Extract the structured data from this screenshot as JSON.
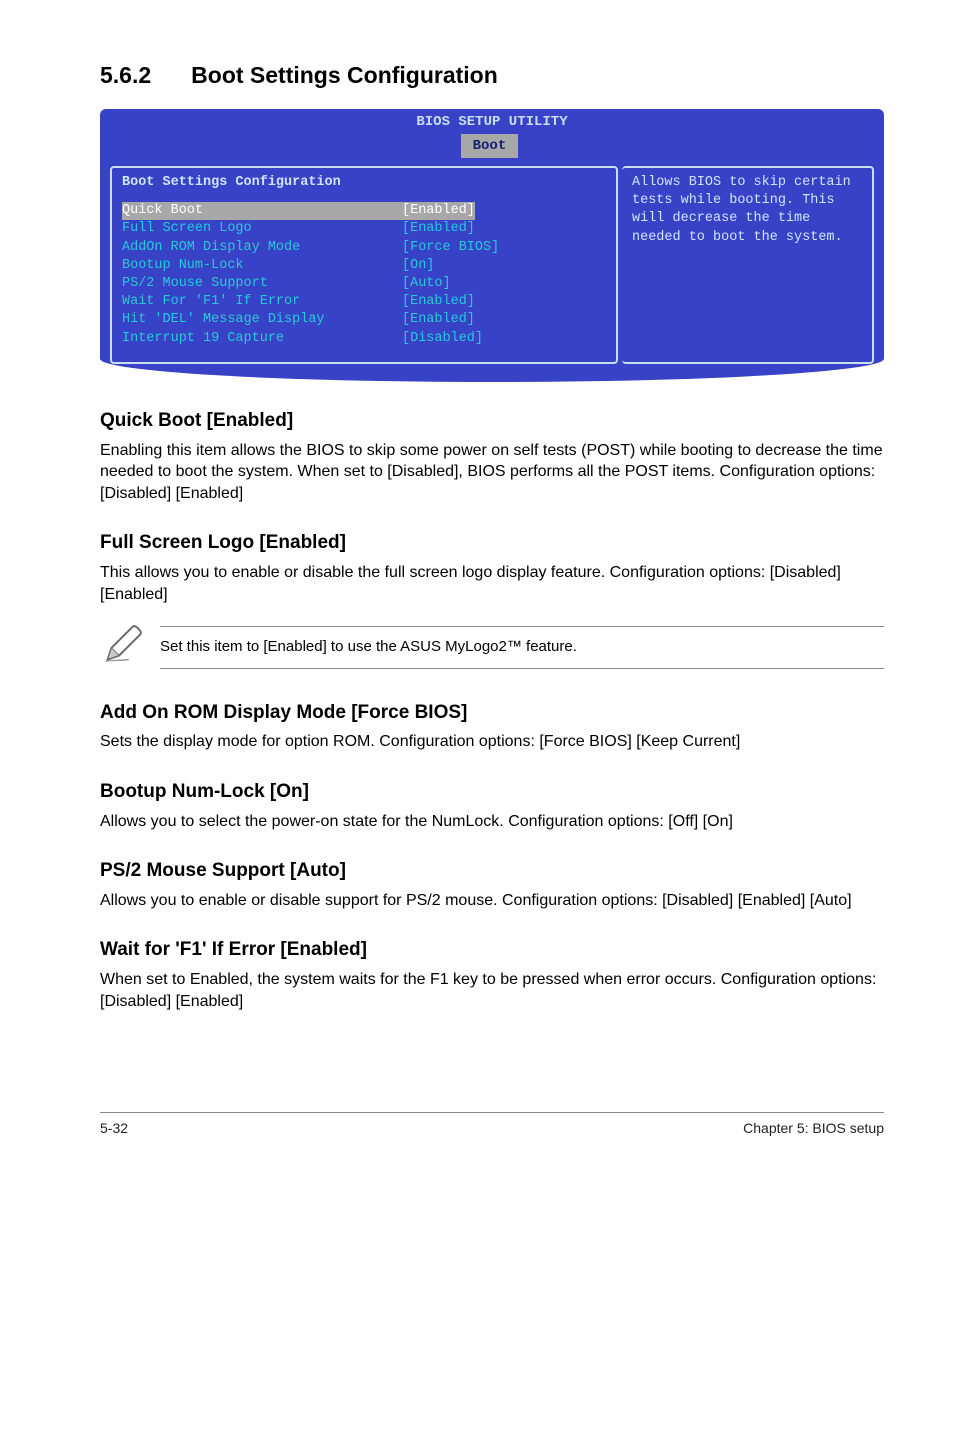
{
  "section": {
    "number": "5.6.2",
    "title": "Boot Settings Configuration"
  },
  "bios": {
    "utility_title": "BIOS SETUP UTILITY",
    "tab": "Boot",
    "panel_heading": "Boot Settings Configuration",
    "rows": [
      {
        "label": "Quick Boot",
        "value": "[Enabled]",
        "selected": true
      },
      {
        "label": "Full Screen Logo",
        "value": "[Enabled]"
      },
      {
        "label": "AddOn ROM Display Mode",
        "value": "[Force BIOS]"
      },
      {
        "label": "Bootup Num-Lock",
        "value": "[On]"
      },
      {
        "label": "PS/2 Mouse Support",
        "value": "[Auto]"
      },
      {
        "label": "Wait For 'F1' If Error",
        "value": "[Enabled]"
      },
      {
        "label": "Hit 'DEL' Message Display",
        "value": "[Enabled]"
      },
      {
        "label": "Interrupt 19 Capture",
        "value": "[Disabled]"
      }
    ],
    "help_text": "Allows BIOS to skip certain tests while booting. This will decrease the time needed to boot the system."
  },
  "sections": {
    "quick_boot": {
      "heading": "Quick Boot [Enabled]",
      "body": "Enabling this item allows the BIOS to skip some power on self tests (POST) while booting to decrease the time needed to boot the system. When set to [Disabled], BIOS performs all the POST items. Configuration options: [Disabled] [Enabled]"
    },
    "full_screen_logo": {
      "heading": "Full Screen Logo [Enabled]",
      "body": "This allows you to enable or disable the full screen logo display feature. Configuration options: [Disabled] [Enabled]"
    },
    "note": {
      "text": "Set this item to [Enabled] to use the ASUS MyLogo2™ feature."
    },
    "addon_rom": {
      "heading": "Add On ROM Display Mode [Force BIOS]",
      "body": "Sets the display mode for option ROM. Configuration options: [Force BIOS] [Keep Current]"
    },
    "bootup_numlock": {
      "heading": "Bootup Num-Lock [On]",
      "body": "Allows you to select the power-on state for the NumLock. Configuration options: [Off] [On]"
    },
    "ps2_mouse": {
      "heading": "PS/2 Mouse Support [Auto]",
      "body": "Allows you to enable or disable support for PS/2 mouse. Configuration options: [Disabled] [Enabled] [Auto]"
    },
    "wait_f1": {
      "heading": "Wait for 'F1' If Error [Enabled]",
      "body": "When set to Enabled, the system waits for the F1 key to be pressed when error occurs. Configuration options: [Disabled] [Enabled]"
    }
  },
  "footer": {
    "left": "5-32",
    "right": "Chapter 5: BIOS setup"
  }
}
